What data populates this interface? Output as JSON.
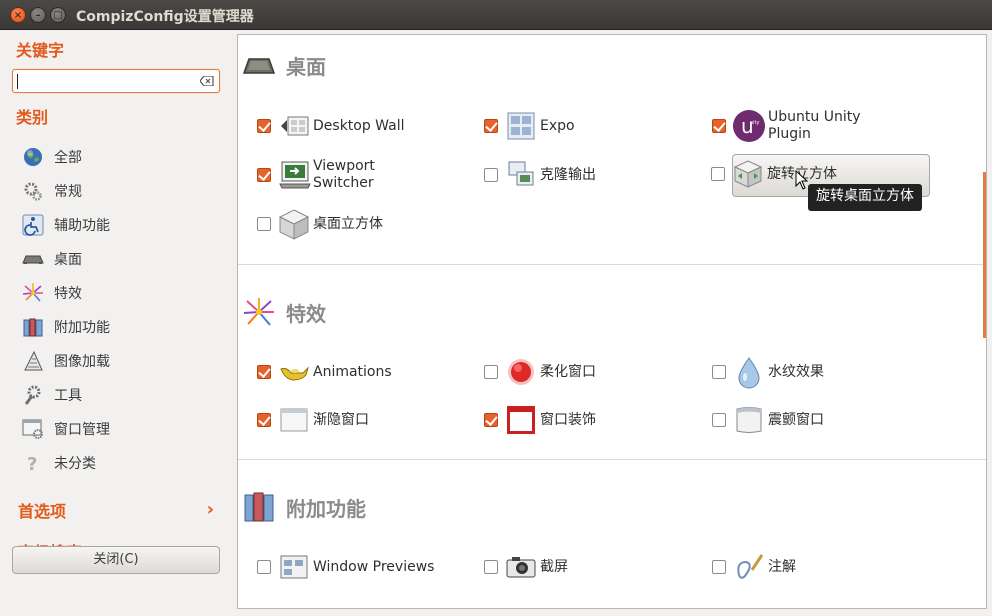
{
  "window": {
    "title": "CompizConfig设置管理器"
  },
  "sidebar": {
    "keyword_label": "关键字",
    "search": {
      "value": ""
    },
    "category_label": "类别",
    "categories": [
      {
        "label": "全部",
        "icon": "globe-icon"
      },
      {
        "label": "常规",
        "icon": "gears-icon"
      },
      {
        "label": "辅助功能",
        "icon": "accessibility-icon"
      },
      {
        "label": "桌面",
        "icon": "desktop-icon"
      },
      {
        "label": "特效",
        "icon": "fireworks-icon"
      },
      {
        "label": "附加功能",
        "icon": "extras-icon"
      },
      {
        "label": "图像加载",
        "icon": "image-loading-icon"
      },
      {
        "label": "工具",
        "icon": "tools-icon"
      },
      {
        "label": "窗口管理",
        "icon": "window-management-icon"
      },
      {
        "label": "未分类",
        "icon": "question-icon"
      }
    ],
    "preferences_label": "首选项",
    "advanced_search_label": "高级搜索",
    "close_button": "关闭(C)"
  },
  "groups": [
    {
      "title": "桌面",
      "plugins": [
        {
          "label": "Desktop Wall",
          "checked": true,
          "icon": "desktop-wall-icon"
        },
        {
          "label": "Expo",
          "checked": true,
          "icon": "expo-icon"
        },
        {
          "label": "Ubuntu Unity Plugin",
          "checked": true,
          "icon": "unity-icon"
        },
        {
          "label": "Viewport Switcher",
          "checked": true,
          "icon": "viewport-switcher-icon"
        },
        {
          "label": "克隆输出",
          "checked": false,
          "icon": "clone-output-icon"
        },
        {
          "label": "旋转立方体",
          "checked": false,
          "icon": "rotate-cube-icon"
        },
        {
          "label": "桌面立方体",
          "checked": false,
          "icon": "desktop-cube-icon"
        }
      ]
    },
    {
      "title": "特效",
      "plugins": [
        {
          "label": "Animations",
          "checked": true,
          "icon": "animations-lamp-icon"
        },
        {
          "label": "柔化窗口",
          "checked": false,
          "icon": "blur-window-icon"
        },
        {
          "label": "水纹效果",
          "checked": false,
          "icon": "water-drop-icon"
        },
        {
          "label": "渐隐窗口",
          "checked": true,
          "icon": "fade-window-icon"
        },
        {
          "label": "窗口装饰",
          "checked": true,
          "icon": "window-decoration-icon"
        },
        {
          "label": "震颤窗口",
          "checked": false,
          "icon": "wobbly-window-icon"
        }
      ]
    },
    {
      "title": "附加功能",
      "plugins": [
        {
          "label": "Window Previews",
          "checked": false,
          "icon": "window-previews-icon"
        },
        {
          "label": "截屏",
          "checked": false,
          "icon": "camera-icon"
        },
        {
          "label": "注解",
          "checked": false,
          "icon": "annotate-icon"
        }
      ]
    }
  ],
  "tooltip": "旋转桌面立方体",
  "colors": {
    "accent": "#e25a1c",
    "checkbox_on": "#e8622a"
  }
}
